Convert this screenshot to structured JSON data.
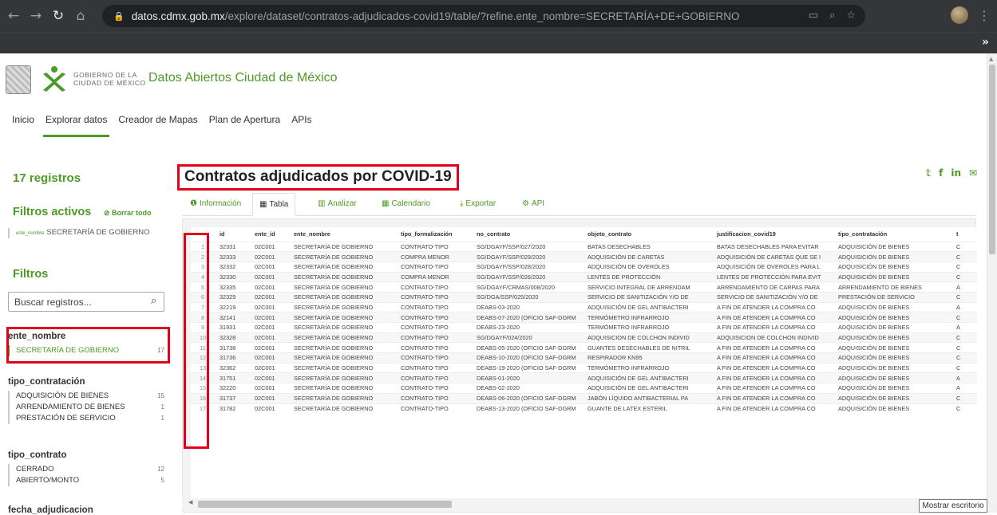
{
  "browser": {
    "url_host": "datos.cdmx.gob.mx",
    "url_path": "/explore/dataset/contratos-adjudicados-covid19/table/?refine.ente_nombre=SECRETARÍA+DE+GOBIERNO",
    "bookmarks_more": "»"
  },
  "site": {
    "logo_text_line1": "GOBIERNO DE LA",
    "logo_text_line2": "CIUDAD DE MÉXICO",
    "title": "Datos Abiertos Ciudad de México",
    "nav": [
      "Inicio",
      "Explorar datos",
      "Creador de Mapas",
      "Plan de Apertura",
      "APIs"
    ]
  },
  "sidebar": {
    "records": "17 registros",
    "active_filters_title": "Filtros activos",
    "clear_all": "⊘ Borrar todo",
    "active_filter_key": "ente_nombre",
    "active_filter_value": "SECRETARÍA DE GOBIERNO",
    "filters_title": "Filtros",
    "search_placeholder": "Buscar registros...",
    "facets": [
      {
        "title": "ente_nombre",
        "items": [
          {
            "label": "SECRETARÍA DE GOBIERNO",
            "count": "17"
          }
        ]
      },
      {
        "title": "tipo_contratación",
        "items": [
          {
            "label": "ADQUISICIÓN DE BIENES",
            "count": "15"
          },
          {
            "label": "ARRENDAMIENTO DE BIENES",
            "count": "1"
          },
          {
            "label": "PRESTACIÓN DE SERVICIO",
            "count": "1"
          }
        ]
      },
      {
        "title": "tipo_contrato",
        "items": [
          {
            "label": "CERRADO",
            "count": "12"
          },
          {
            "label": "ABIERTO/MONTO",
            "count": "5"
          }
        ]
      }
    ],
    "cut_facet": "fecha_adjudicacion"
  },
  "main": {
    "title": "Contratos adjudicados por COVID-19",
    "tabs": [
      {
        "icon": "❶",
        "label": "Información"
      },
      {
        "icon": "▦",
        "label": "Tabla"
      },
      {
        "icon": "▥",
        "label": "Analizar"
      },
      {
        "icon": "▦",
        "label": "Calendario"
      },
      {
        "icon": "⤓",
        "label": "Exportar"
      },
      {
        "icon": "⚙",
        "label": "API"
      }
    ],
    "columns": [
      "",
      "id",
      "ente_id",
      "ente_nombre",
      "tipo_formalización",
      "no_contrato",
      "objeto_contrato",
      "justificacion_covid19",
      "tipo_contratación",
      "t"
    ],
    "rows": [
      [
        "1",
        "32331",
        "02C001",
        "SECRETARÍA DE GOBIERNO",
        "CONTRATO-TIPO",
        "SG/DGAYF/SSP/027/2020",
        "BATAS DESECHABLES",
        "BATAS DESECHABLES PARA EVITAR",
        "ADQUISICIÓN DE BIENES",
        "C"
      ],
      [
        "2",
        "32333",
        "02C001",
        "SECRETARÍA DE GOBIERNO",
        "COMPRA MENOR",
        "SG/DGAYF/SSP/029/2020",
        "ADQUISICIÓN DE CARETAS",
        "ADQUISICIÓN DE CARETAS QUE SE I",
        "ADQUISICIÓN DE BIENES",
        "C"
      ],
      [
        "3",
        "32332",
        "02C001",
        "SECRETARÍA DE GOBIERNO",
        "CONTRATO-TIPO",
        "SG/DGAYF/SSP/028/2020",
        "ADQUISICIÓN DE OVEROLES",
        "ADQUISICIÓN DE OVEROLES PARA L",
        "ADQUISICIÓN DE BIENES",
        "C"
      ],
      [
        "4",
        "32330",
        "02C001",
        "SECRETARÍA DE GOBIERNO",
        "COMPRA MENOR",
        "SG/DGAYF/SSP/026/2020",
        "LENTES DE PROTECCIÓN",
        "LENTES DE PROTECCIÓN PARA EVIT",
        "ADQUISICIÓN DE BIENES",
        "C"
      ],
      [
        "5",
        "32335",
        "02C001",
        "SECRETARÍA DE GOBIERNO",
        "CONTRATO-TIPO",
        "SG/DGAYF/CRMAS/008/2020",
        "SERVICIO INTEGRAL DE ARRENDAM",
        "ARRENDAMIENTO DE CARPAS PARA",
        "ARRENDAMIENTO DE BIENES",
        "A"
      ],
      [
        "6",
        "32329",
        "02C001",
        "SECRETARÍA DE GOBIERNO",
        "CONTRATO-TIPO",
        "SG/DGA/SSP/025/2020",
        "SERVICIO DE SANITIZACIÓN Y/O DE",
        "SERVICIO DE SANITIZACIÓN Y/O DE",
        "PRESTACIÓN DE SERVICIO",
        "C"
      ],
      [
        "7",
        "32219",
        "02C001",
        "SECRETARÍA DE GOBIERNO",
        "CONTRATO-TIPO",
        "DEABS-03-2020",
        "ADQUISICIÓN DE GEL ANTIBACTERI",
        "A FIN DE ATENDER LA COMPRA CO",
        "ADQUISICIÓN DE BIENES",
        "A"
      ],
      [
        "8",
        "32141",
        "02C001",
        "SECRETARÍA DE GOBIERNO",
        "CONTRATO-TIPO",
        "DEABS-07-2020 (OFICIO SAF-DGRM",
        "TERMÓMETRO INFRARROJO",
        "A FIN DE ATENDER LA COMPRA CO",
        "ADQUISICIÓN DE BIENES",
        "C"
      ],
      [
        "9",
        "31931",
        "02C001",
        "SECRETARÍA DE GOBIERNO",
        "CONTRATO-TIPO",
        "DEABS-23-2020",
        "TERMÓMETRO INFRARROJO",
        "A FIN DE ATENDER LA COMPRA CO",
        "ADQUISICIÓN DE BIENES",
        "A"
      ],
      [
        "10",
        "32328",
        "02C001",
        "SECRETARÍA DE GOBIERNO",
        "CONTRATO-TIPO",
        "SG/DGAYF/024/2020",
        "ADQUISICION DE COLCHON INDIVID",
        "ADQUISICION DE COLCHON INDIVID",
        "ADQUISICIÓN DE BIENES",
        "C"
      ],
      [
        "11",
        "31738",
        "02C001",
        "SECRETARÍA DE GOBIERNO",
        "CONTRATO-TIPO",
        "DEABS-05-2020 (OFICIO SAF-DGRM",
        "GUANTES DESECHABLES DE NITRIL",
        "A FIN DE ATENDER LA COMPRA CO",
        "ADQUISICIÓN DE BIENES",
        "C"
      ],
      [
        "12",
        "31736",
        "02C001",
        "SECRETARÍA DE GOBIERNO",
        "CONTRATO-TIPO",
        "DEABS-10-2020 (OFICIO SAF-DGRM",
        "RESPIRADOR KN95",
        "A FIN DE ATENDER LA COMPRA CO",
        "ADQUISICIÓN DE BIENES",
        "C"
      ],
      [
        "13",
        "32362",
        "02C001",
        "SECRETARÍA DE GOBIERNO",
        "CONTRATO-TIPO",
        "DEABS-19-2020 (OFICIO SAF-DGRM",
        "TERMÓMETRO INFRARROJO",
        "A FIN DE ATENDER LA COMPRA CO",
        "ADQUISICIÓN DE BIENES",
        "C"
      ],
      [
        "14",
        "31751",
        "02C001",
        "SECRETARÍA DE GOBIERNO",
        "CONTRATO-TIPO",
        "DEABS-01-2020",
        "ADQUISICIÓN DE GEL ANTIBACTERI",
        "A FIN DE ATENDER LA COMPRA CO",
        "ADQUISICIÓN DE BIENES",
        "A"
      ],
      [
        "15",
        "32220",
        "02C001",
        "SECRETARÍA DE GOBIERNO",
        "CONTRATO-TIPO",
        "DEABS-02-2020",
        "ADQUISICIÓN DE GEL ANTIBACTERI",
        "A FIN DE ATENDER LA COMPRA CO",
        "ADQUISICIÓN DE BIENES",
        "A"
      ],
      [
        "16",
        "31737",
        "02C001",
        "SECRETARÍA DE GOBIERNO",
        "CONTRATO-TIPO",
        "DEABS-06-2020 (OFICIO SAF-DGRM",
        "JABÓN LÍQUIDO ANTIBACTERIAL PA",
        "A FIN DE ATENDER LA COMPRA CO",
        "ADQUISICIÓN DE BIENES",
        "C"
      ],
      [
        "17",
        "31782",
        "02C001",
        "SECRETARÍA DE GOBIERNO",
        "CONTRATO-TIPO",
        "DEABS-13-2020 (OFICIO SAF-DGRM",
        "GUANTE DE LATEX ESTERIL",
        "A FIN DE ATENDER LA COMPRA CO",
        "ADQUISICIÓN DE BIENES",
        "C"
      ]
    ]
  },
  "tooltip": "Mostrar escritorio",
  "colors": {
    "brand_green": "#4d9a26",
    "highlight_red": "#e3001b",
    "chrome_dark": "#35363a"
  }
}
